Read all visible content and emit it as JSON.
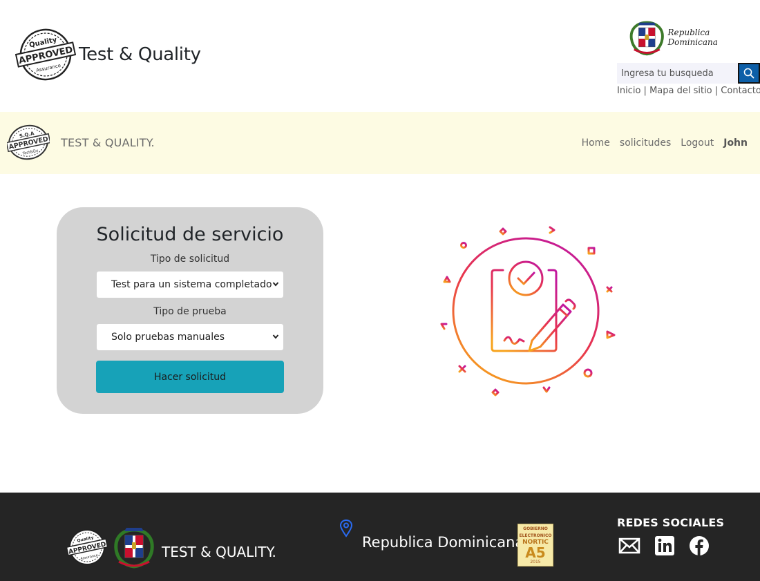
{
  "header": {
    "brand_title": "Test & Quality",
    "logo_top_text": "Quality",
    "logo_main_text": "APPROVED",
    "logo_bottom_text": "Assurance",
    "gov_logo_text": "Republica Dominicana",
    "search": {
      "placeholder": "Ingresa tu busqueda",
      "icon": "search-icon"
    },
    "links": [
      {
        "label": "Inicio"
      },
      {
        "label": "Mapa del sitio"
      },
      {
        "label": "Contacto"
      }
    ],
    "link_separator": " | "
  },
  "navbar": {
    "brand_text": "TEST & QUALITY.",
    "logo_top_text": "S.Q.A",
    "logo_main_text": "APPROVED",
    "logo_bottom_text": "Test&Qu",
    "items": [
      {
        "label": "Home"
      },
      {
        "label": "solicitudes"
      },
      {
        "label": "Logout"
      }
    ],
    "user": "John"
  },
  "form": {
    "title": "Solicitud de servicio",
    "request_type_label": "Tipo de solicitud",
    "request_type_value": "Test para un sistema completado",
    "test_type_label": "Tipo de prueba",
    "test_type_value": "Solo pruebas manuales",
    "submit_label": "Hacer solicitud"
  },
  "illustration": {
    "icon": "clipboard-checklist-icon"
  },
  "footer": {
    "brand_text": "TEST & QUALITY.",
    "location_icon": "map-pin-icon",
    "location_text": "Republica Dominicana",
    "badge": {
      "line1": "GOBIERNO",
      "line2": "ELECTRONICO",
      "line3": "NORTIC",
      "line4": "A5",
      "line5": "2015"
    },
    "social_title": "REDES SOCIALES",
    "social_icons": [
      "mail-icon",
      "linkedin-icon",
      "facebook-icon"
    ]
  },
  "colors": {
    "navbar_bg": "#fdfbe3",
    "footer_bg": "#252525",
    "card_bg": "#d3d3d3",
    "submit_bg": "#17a2b8",
    "search_button_bg": "#0d5fa8",
    "gradient_start": "#f7a31c",
    "gradient_mid": "#e8344e",
    "gradient_end": "#c2189d"
  }
}
